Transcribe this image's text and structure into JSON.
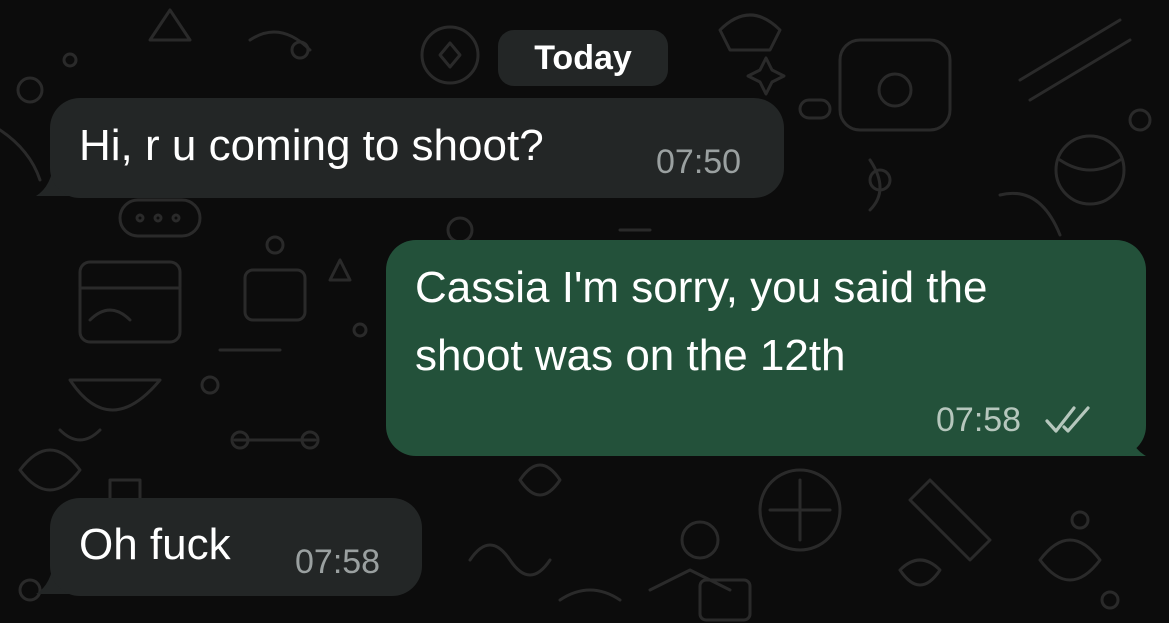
{
  "date_separator": "Today",
  "messages": [
    {
      "direction": "incoming",
      "text": "Hi, r u coming to shoot?",
      "time": "07:50"
    },
    {
      "direction": "outgoing",
      "lines": [
        "Cassia I'm sorry, you said the",
        "shoot was on the 12th"
      ],
      "time": "07:58",
      "status": "read"
    },
    {
      "direction": "incoming",
      "text": "Oh fuck",
      "time": "07:58"
    }
  ],
  "colors": {
    "background": "#0c0c0c",
    "incoming_bubble": "#232626",
    "outgoing_bubble": "#23513a",
    "timestamp": "#9aa0a0",
    "read_ticks": "#b6c7bd"
  },
  "icons": [
    "double-check-read-icon"
  ]
}
